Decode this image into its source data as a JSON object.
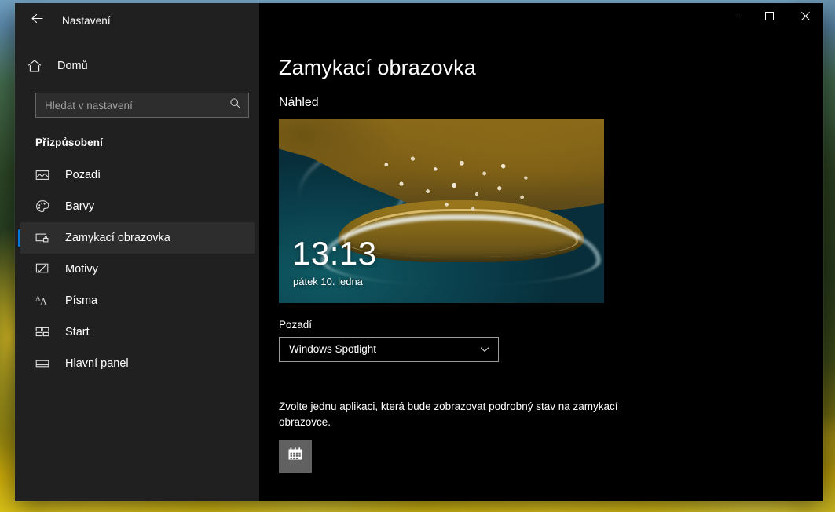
{
  "window": {
    "app_title": "Nastavení",
    "back_icon": "back-arrow-icon",
    "minimize_label": "─",
    "maximize_label": "□",
    "close_label": "✕",
    "accent_color": "#0078d7",
    "sidebar_bg": "#202020",
    "content_bg": "#000000"
  },
  "sidebar": {
    "home": {
      "label": "Domů",
      "icon": "home-icon"
    },
    "search": {
      "value": "",
      "placeholder": "Hledat v nastavení",
      "icon": "search-icon"
    },
    "section_header": "Přizpůsobení",
    "items": [
      {
        "label": "Pozadí",
        "icon": "image-icon",
        "selected": false
      },
      {
        "label": "Barvy",
        "icon": "palette-icon",
        "selected": false
      },
      {
        "label": "Zamykací obrazovka",
        "icon": "lock-screen-icon",
        "selected": true
      },
      {
        "label": "Motivy",
        "icon": "brush-icon",
        "selected": false
      },
      {
        "label": "Písma",
        "icon": "font-icon",
        "selected": false
      },
      {
        "label": "Start",
        "icon": "start-tiles-icon",
        "selected": false
      },
      {
        "label": "Hlavní panel",
        "icon": "taskbar-icon",
        "selected": false
      }
    ]
  },
  "main": {
    "page_title": "Zamykací obrazovka",
    "preview_header": "Náhled",
    "preview": {
      "clock": "13:13",
      "date": "pátek 10. ledna",
      "alt": "Letecký pohled na pobřežní vesnici s tyrkysovým oceánem"
    },
    "background_field": {
      "label": "Pozadí",
      "selected_option": "Windows Spotlight",
      "chevron_icon": "chevron-down-icon"
    },
    "detailed_status": {
      "description": "Zvolte jednu aplikaci, která bude zobrazovat podrobný stav na zamykací obrazovce.",
      "app_tile_icon": "calendar-icon"
    }
  }
}
